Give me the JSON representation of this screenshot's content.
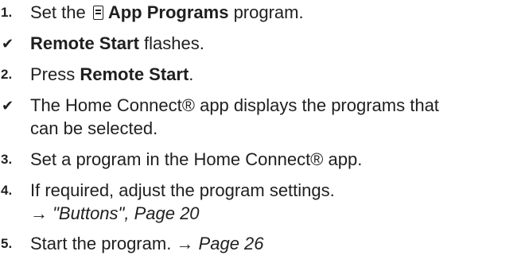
{
  "steps": [
    {
      "marker": "1.",
      "pre": "Set the",
      "bold": "App Programs",
      "post": "program.",
      "icon": "app-programs-icon"
    },
    {
      "marker": "✔",
      "bold": "Remote Start",
      "post": "flashes."
    },
    {
      "marker": "2.",
      "pre": "Press",
      "bold": "Remote Start",
      "post": "."
    },
    {
      "marker": "✔",
      "line1": "The Home Connect® app displays the programs that",
      "line2": "can be selected."
    },
    {
      "marker": "3.",
      "text": "Set a program in the Home Connect® app."
    },
    {
      "marker": "4.",
      "text": "If required, adjust the program settings.",
      "ref_arrow": "→",
      "ref_text": "\"Buttons\", Page 20"
    },
    {
      "marker": "5.",
      "text": "Start the program. →",
      "ref_text": "Page 26"
    }
  ]
}
